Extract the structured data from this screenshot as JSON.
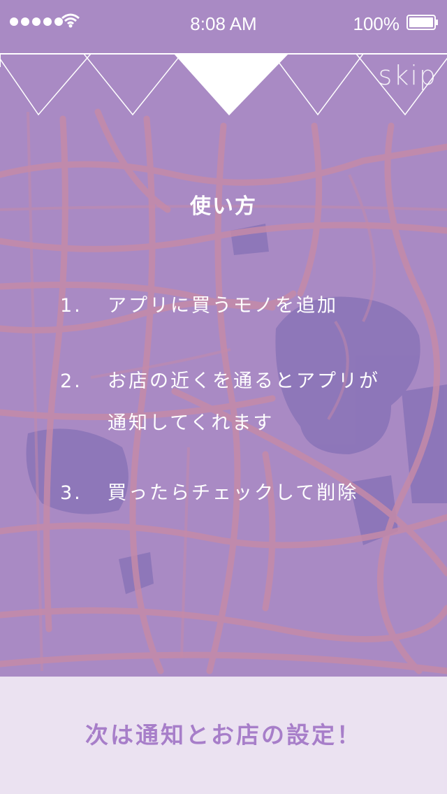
{
  "status_bar": {
    "time": "8:08 AM",
    "battery_percent": "100%",
    "signal_icon": "signal-dots-icon",
    "wifi_icon": "wifi-icon",
    "battery_icon": "battery-icon"
  },
  "onboarding": {
    "page_indicator": {
      "pages": 5,
      "current": 3
    },
    "skip_label": "skip",
    "title": "使い方",
    "steps": [
      {
        "num": "1.",
        "lines": [
          "アプリに買うモノを追加"
        ]
      },
      {
        "num": "2.",
        "lines": [
          "お店の近くを通るとアプリが",
          "通知してくれます"
        ]
      },
      {
        "num": "3.",
        "lines": [
          "買ったらチェックして削除"
        ]
      }
    ],
    "next_label": "次は通知とお店の設定！"
  },
  "colors": {
    "background": "#a98ac4",
    "road": "#c58aa8",
    "footer_bg": "#f0e8f4",
    "accent": "#a77ec9"
  }
}
